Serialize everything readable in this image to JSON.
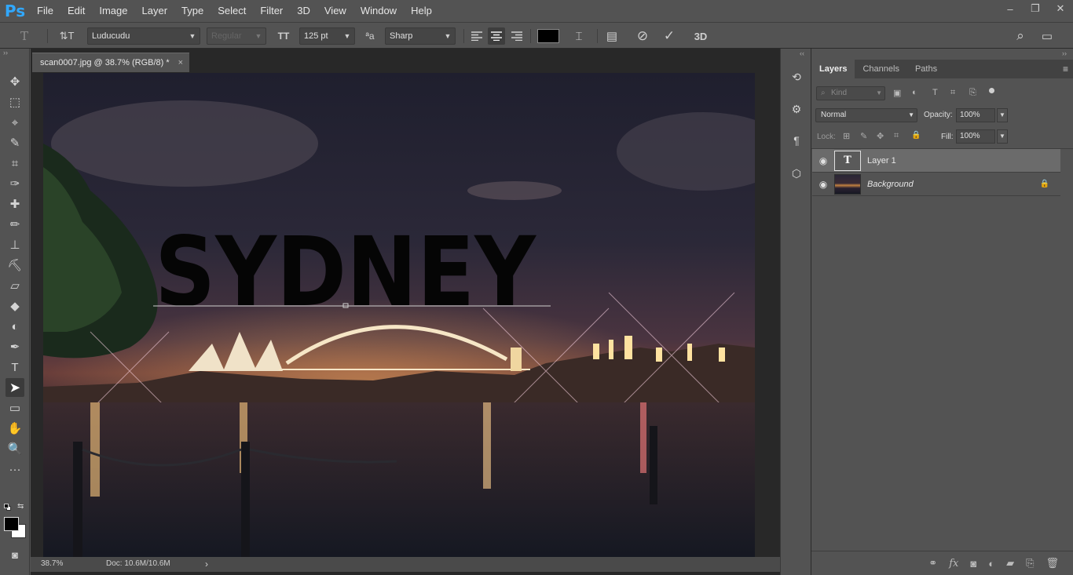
{
  "app": {
    "logo": "Ps"
  },
  "menu": [
    "File",
    "Edit",
    "Image",
    "Layer",
    "Type",
    "Select",
    "Filter",
    "3D",
    "View",
    "Window",
    "Help"
  ],
  "window_controls": {
    "minimize": "–",
    "restore": "❐",
    "close": "✕"
  },
  "options": {
    "tool_icon": "T",
    "orient_icon": "⇅T",
    "font_family": "Luducudu",
    "font_style": "Regular",
    "font_size_icon": "TT",
    "font_size": "125 pt",
    "aa_icon": "ªa",
    "antialias": "Sharp",
    "text_color": "#000000",
    "warp_icon": "⌶",
    "panels_icon": "▤",
    "cancel_icon": "⊘",
    "commit_icon": "✓",
    "threed_label": "3D",
    "search_icon": "⌕",
    "workspace_icon": "▭"
  },
  "document": {
    "tab_title": "scan0007.jpg @ 38.7% (RGB/8) *",
    "close_glyph": "×",
    "overlay_text": "SYDNEY",
    "zoom": "38.7%",
    "doc_size": "Doc: 10.6M/10.6M",
    "status_arrow": "›"
  },
  "toolbar_collapse": "››",
  "panel_collapse_left": "‹‹",
  "panel_collapse_right": "››",
  "panel_menu_icon": "≡",
  "layers_panel": {
    "tabs": [
      "Layers",
      "Channels",
      "Paths"
    ],
    "filter_placeholder": "Kind",
    "filter_icons": [
      "▣",
      "◐",
      "T",
      "⌗",
      "⎘"
    ],
    "blend_mode": "Normal",
    "opacity_label": "Opacity:",
    "opacity": "100%",
    "lock_label": "Lock:",
    "lock_icons": [
      "⊞",
      "✎",
      "✥",
      "⌗",
      "🔒"
    ],
    "fill_label": "Fill:",
    "fill": "100%",
    "layers": [
      {
        "name": "Layer 1",
        "type": "text",
        "visible_icon": "◉",
        "thumb_label": "T"
      },
      {
        "name": "Background",
        "type": "image",
        "visible_icon": "◉",
        "locked_icon": "🔒"
      }
    ],
    "footer_icons": [
      "⚭",
      "fx",
      "◙",
      "◐",
      "▰",
      "⎘",
      "🗑"
    ]
  },
  "tools": [
    "✥",
    "⬚",
    "⌖",
    "✎",
    "⌗",
    "✑",
    "✚",
    "✏",
    "⊥",
    "⛏",
    "▱",
    "◆",
    "◐",
    "✒",
    "T",
    "➤",
    "▭",
    "✋",
    "🔍",
    "···"
  ],
  "colors": {
    "bg": "#535353",
    "accent": "#31a8ff",
    "selected_row": "#6b6b6b"
  }
}
